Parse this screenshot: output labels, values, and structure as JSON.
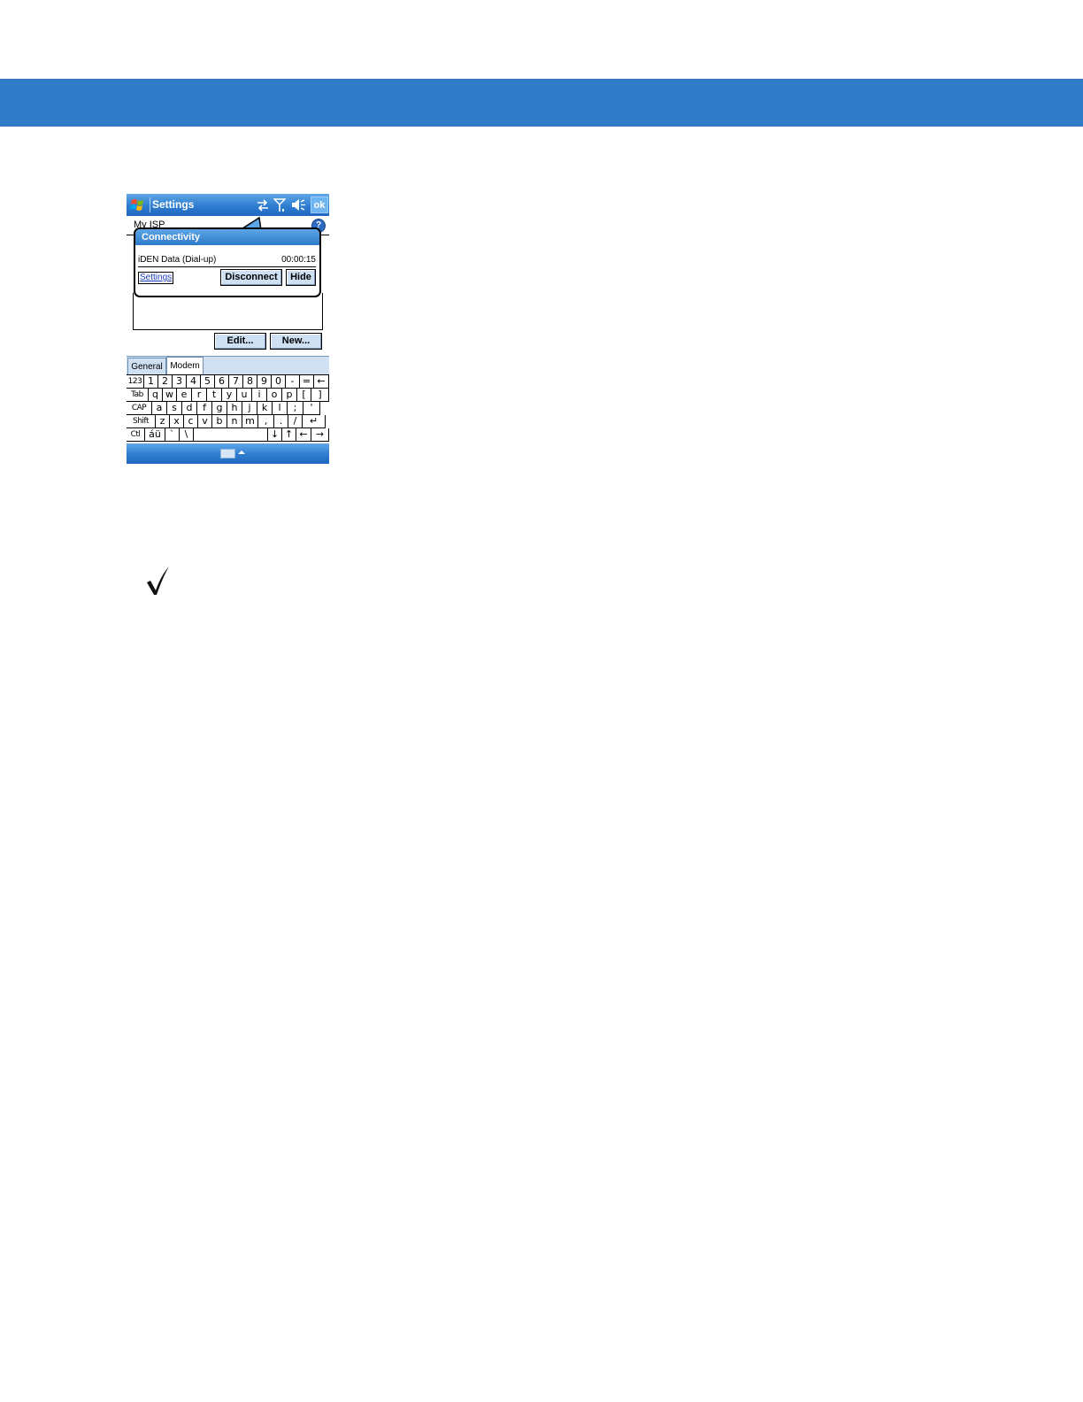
{
  "window": {
    "title": "Settings",
    "ok_label": "ok",
    "section_label": "My ISP"
  },
  "bubble": {
    "title": "Connectivity",
    "connection_name": "iDEN Data (Dial-up)",
    "elapsed_time": "00:00:15",
    "settings_link": "Settings",
    "disconnect_label": "Disconnect",
    "hide_label": "Hide"
  },
  "buttons": {
    "edit_label": "Edit...",
    "new_label": "New..."
  },
  "tabs": [
    {
      "label": "General",
      "active": false
    },
    {
      "label": "Modem",
      "active": true
    }
  ],
  "keyboard": {
    "rows": [
      [
        "123",
        "1",
        "2",
        "3",
        "4",
        "5",
        "6",
        "7",
        "8",
        "9",
        "0",
        "-",
        "=",
        "←"
      ],
      [
        "Tab",
        "q",
        "w",
        "e",
        "r",
        "t",
        "y",
        "u",
        "i",
        "o",
        "p",
        "[",
        "]"
      ],
      [
        "CAP",
        "a",
        "s",
        "d",
        "f",
        "g",
        "h",
        "j",
        "k",
        "l",
        ";",
        "'"
      ],
      [
        "Shift",
        "z",
        "x",
        "c",
        "v",
        "b",
        "n",
        "m",
        ",",
        ".",
        "/",
        "↵"
      ],
      [
        "Ctl",
        "áü",
        "`",
        "\\",
        " ",
        "↓",
        "↑",
        "←",
        "→"
      ]
    ]
  },
  "icons": {
    "start": "windows-flag-icon",
    "connectivity": "connectivity-arrows-icon",
    "signal": "signal-antenna-icon",
    "volume": "speaker-icon",
    "help": "help-icon",
    "input_panel": "keyboard-icon",
    "note": "checkmark-icon"
  },
  "colors": {
    "header_band": "#2f7bc8",
    "titlebar": "#2f7dd0",
    "button_face": "#cfe0f3"
  }
}
